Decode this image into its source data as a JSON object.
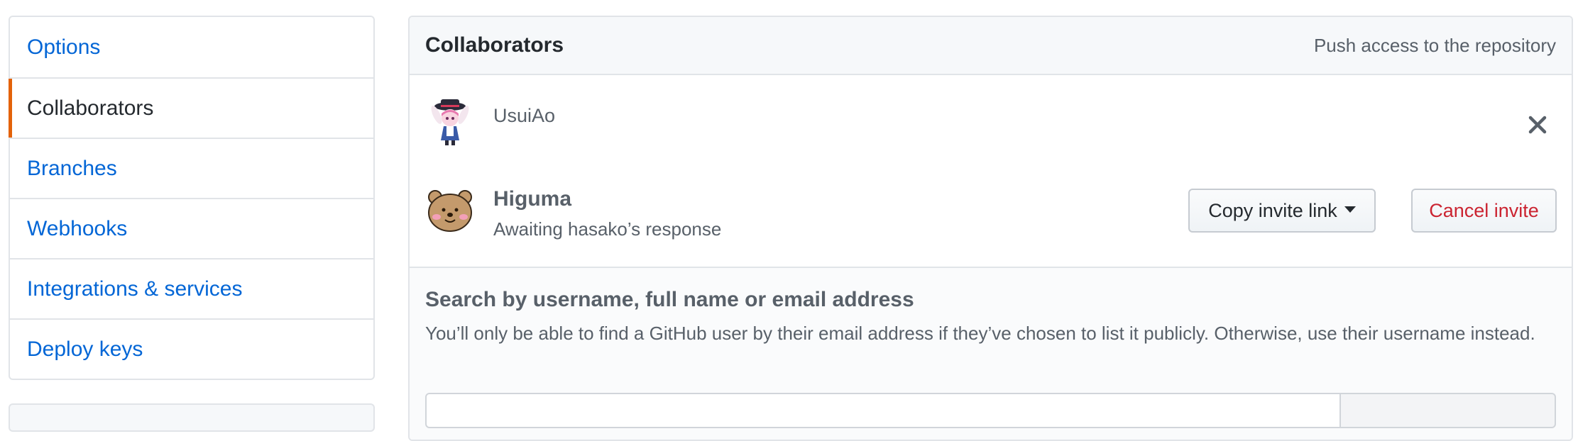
{
  "sidebar": {
    "items": [
      {
        "label": "Options"
      },
      {
        "label": "Collaborators"
      },
      {
        "label": "Branches"
      },
      {
        "label": "Webhooks"
      },
      {
        "label": "Integrations & services"
      },
      {
        "label": "Deploy keys"
      }
    ],
    "selected": "Collaborators"
  },
  "panel": {
    "title": "Collaborators",
    "note": "Push access to the repository"
  },
  "collaborators": [
    {
      "username": "UsuiAo",
      "avatar_icon": "anime-girl-avatar-icon"
    },
    {
      "username": "Higuma",
      "status": "Awaiting hasako’s response",
      "avatar_icon": "bear-avatar-icon"
    }
  ],
  "invite_actions": {
    "copy_label": "Copy invite link",
    "cancel_label": "Cancel invite"
  },
  "search": {
    "title": "Search by username, full name or email address",
    "help": "You’ll only be able to find a GitHub user by their email address if they’ve chosen to list it publicly. Otherwise, use their username instead."
  },
  "colors": {
    "link": "#0366d6",
    "selected_marker": "#e36209",
    "danger": "#cb2431"
  }
}
